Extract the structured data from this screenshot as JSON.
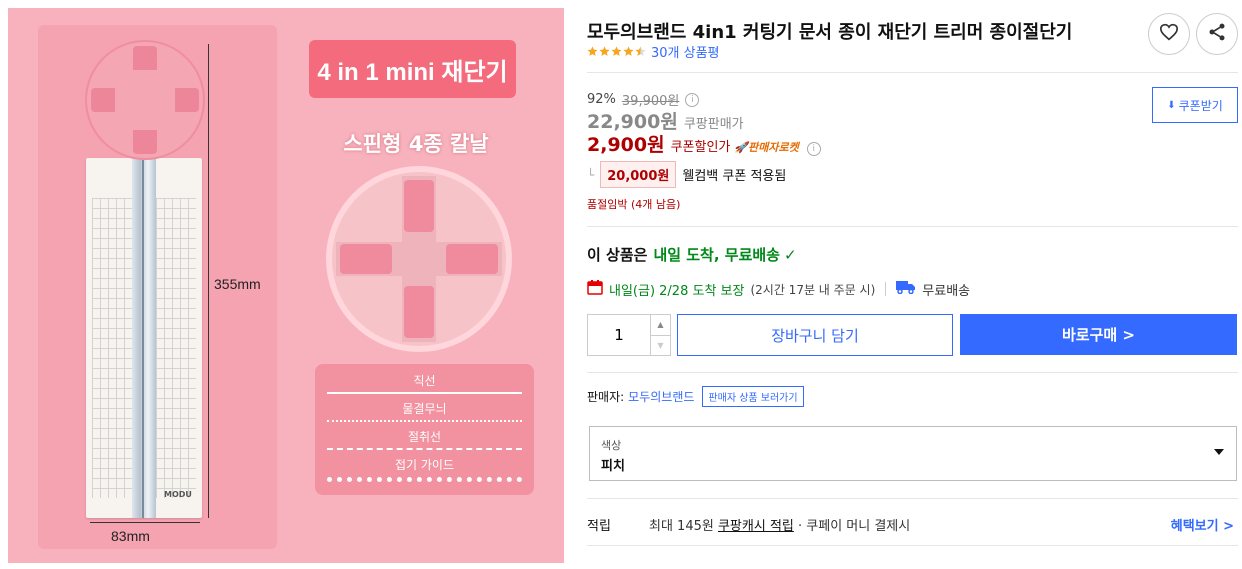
{
  "image": {
    "headline": "4 in 1 mini 재단기",
    "subheadline": "스핀형 4종 칼날",
    "height_dim": "355mm",
    "width_dim": "83mm",
    "brand_mark": "MODU",
    "blades": [
      "직선",
      "물결무늬",
      "절취선",
      "접기 가이드"
    ]
  },
  "product": {
    "title": "모두의브랜드 4in1 커팅기 문서 종이 재단기 트리머 종이절단기",
    "rating": 4.5,
    "review_count": "30개 상품평"
  },
  "actions": {
    "wishlist_icon": "heart-icon",
    "share_icon": "share-icon"
  },
  "price": {
    "discount_rate": "92%",
    "original_price": "39,900원",
    "sale_price": "22,900원",
    "sale_label": "쿠팡판매가",
    "coupon_price": "2,900원",
    "coupon_label": "쿠폰할인가",
    "rocket_label": "판매자로켓",
    "coupon_button": "쿠폰받기",
    "cashback_amount": "20,000원",
    "cashback_text": "웰컴백 쿠폰 적용됨",
    "stock_notice": "품절임박 (4개 남음)"
  },
  "delivery": {
    "headline_prefix": "이 상품은",
    "headline_highlight": "내일 도착, 무료배송",
    "arrival_main": "내일(금) 2/28 도착 보장",
    "arrival_note": "(2시간 17분 내 주문 시)",
    "shipping": "무료배송"
  },
  "purchase": {
    "quantity": "1",
    "cart_button": "장바구니 담기",
    "buy_button": "바로구매 >"
  },
  "seller": {
    "label": "판매자:",
    "name": "모두의브랜드",
    "link": "판매자 상품 보러가기"
  },
  "option": {
    "label": "색상",
    "value": "피치"
  },
  "points": {
    "title": "적립",
    "text_prefix": "최대 145원",
    "link": "쿠팡캐시 적립",
    "text_suffix": "· 쿠페이 머니 결제시",
    "benefits": "혜택보기 >"
  },
  "colors": {
    "accent_blue": "#346aff",
    "price_red": "#ae0000",
    "delivery_green": "#00891a",
    "image_pink": "#f7b2bd"
  }
}
